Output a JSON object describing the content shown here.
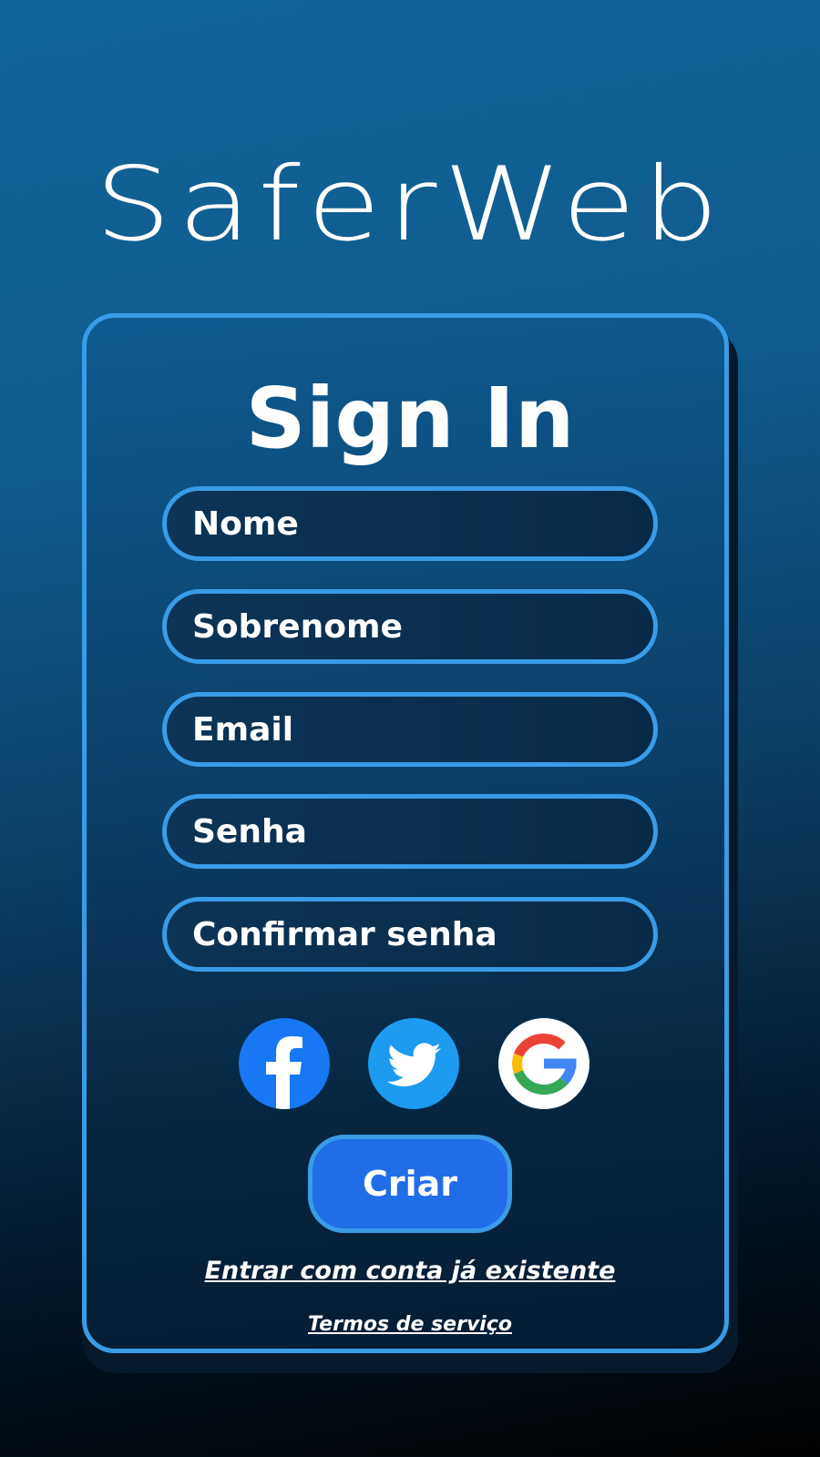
{
  "brand": {
    "logo_text": "SaferWeb"
  },
  "form": {
    "title": "Sign In",
    "fields": [
      {
        "placeholder": "Nome",
        "value": ""
      },
      {
        "placeholder": "Sobrenome",
        "value": ""
      },
      {
        "placeholder": "Email",
        "value": ""
      },
      {
        "placeholder": "Senha",
        "value": ""
      },
      {
        "placeholder": "Confirmar senha",
        "value": ""
      }
    ],
    "social": [
      {
        "icon": "facebook-icon"
      },
      {
        "icon": "twitter-icon"
      },
      {
        "icon": "google-icon"
      }
    ],
    "submit_label": "Criar",
    "login_link": "Entrar com conta já existente",
    "terms_link": "Termos de serviço"
  },
  "colors": {
    "accent_border": "#3a9be6",
    "button": "#216de8",
    "facebook": "#1877f2",
    "twitter": "#1d9bf0",
    "google_blue": "#4285f4",
    "google_red": "#ea4335",
    "google_yellow": "#fbbc05",
    "google_green": "#34a853"
  }
}
